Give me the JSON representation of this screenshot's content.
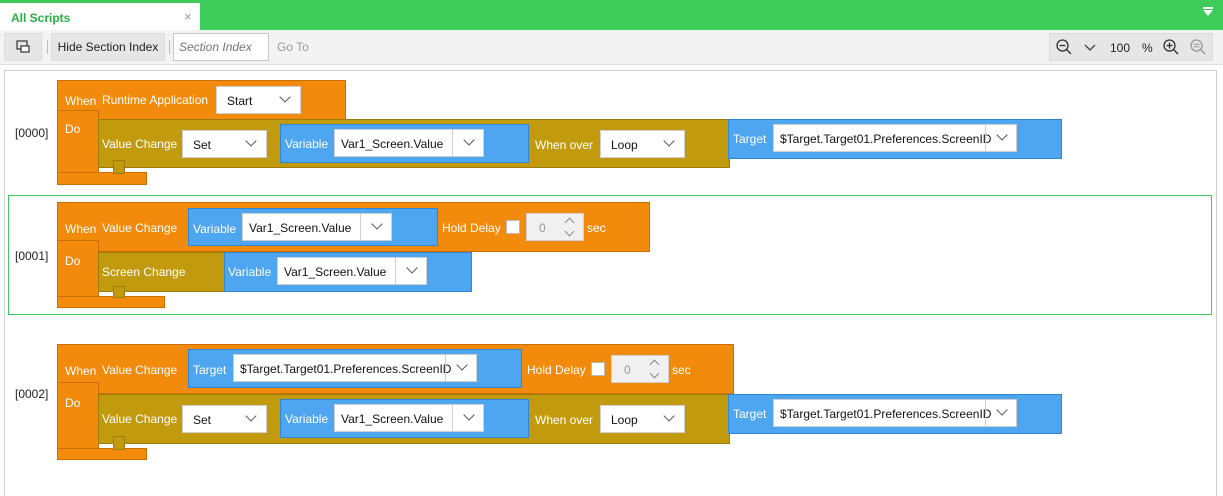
{
  "tab": {
    "title": "All Scripts",
    "close": "×"
  },
  "toolbar": {
    "hide_section_index": "Hide Section Index",
    "section_index_placeholder": "Section Index",
    "go_to": "Go To",
    "zoom_value": "100",
    "zoom_unit": "%"
  },
  "sections": [
    {
      "index": "[0000]",
      "when_label": "When",
      "do_label": "Do",
      "trigger": {
        "label": "Runtime Application",
        "option": "Start"
      },
      "action": {
        "label": "Value Change",
        "mode": "Set",
        "variable_label": "Variable",
        "variable": "Var1_Screen.Value",
        "when_over_label": "When over",
        "when_over": "Loop",
        "target_label": "Target",
        "target": "$Target.Target01.Preferences.ScreenID"
      }
    },
    {
      "index": "[0001]",
      "when_label": "When",
      "do_label": "Do",
      "trigger": {
        "label": "Value Change",
        "variable_label": "Variable",
        "variable": "Var1_Screen.Value",
        "hold_delay_label": "Hold Delay",
        "hold_delay_value": "0",
        "unit": "sec"
      },
      "action": {
        "label": "Screen Change",
        "variable_label": "Variable",
        "variable": "Var1_Screen.Value"
      }
    },
    {
      "index": "[0002]",
      "when_label": "When",
      "do_label": "Do",
      "trigger": {
        "label": "Value Change",
        "target_label": "Target",
        "target": "$Target.Target01.Preferences.ScreenID",
        "hold_delay_label": "Hold Delay",
        "hold_delay_value": "0",
        "unit": "sec"
      },
      "action": {
        "label": "Value Change",
        "mode": "Set",
        "variable_label": "Variable",
        "variable": "Var1_Screen.Value",
        "when_over_label": "When over",
        "when_over": "Loop",
        "target_label": "Target",
        "target": "$Target.Target01.Preferences.ScreenID"
      }
    }
  ],
  "colors": {
    "accent_green": "#3dcc5a",
    "when_block_orange": "#f28a0b",
    "action_block_olive": "#c29a0d",
    "param_block_blue": "#4ea5f0"
  }
}
